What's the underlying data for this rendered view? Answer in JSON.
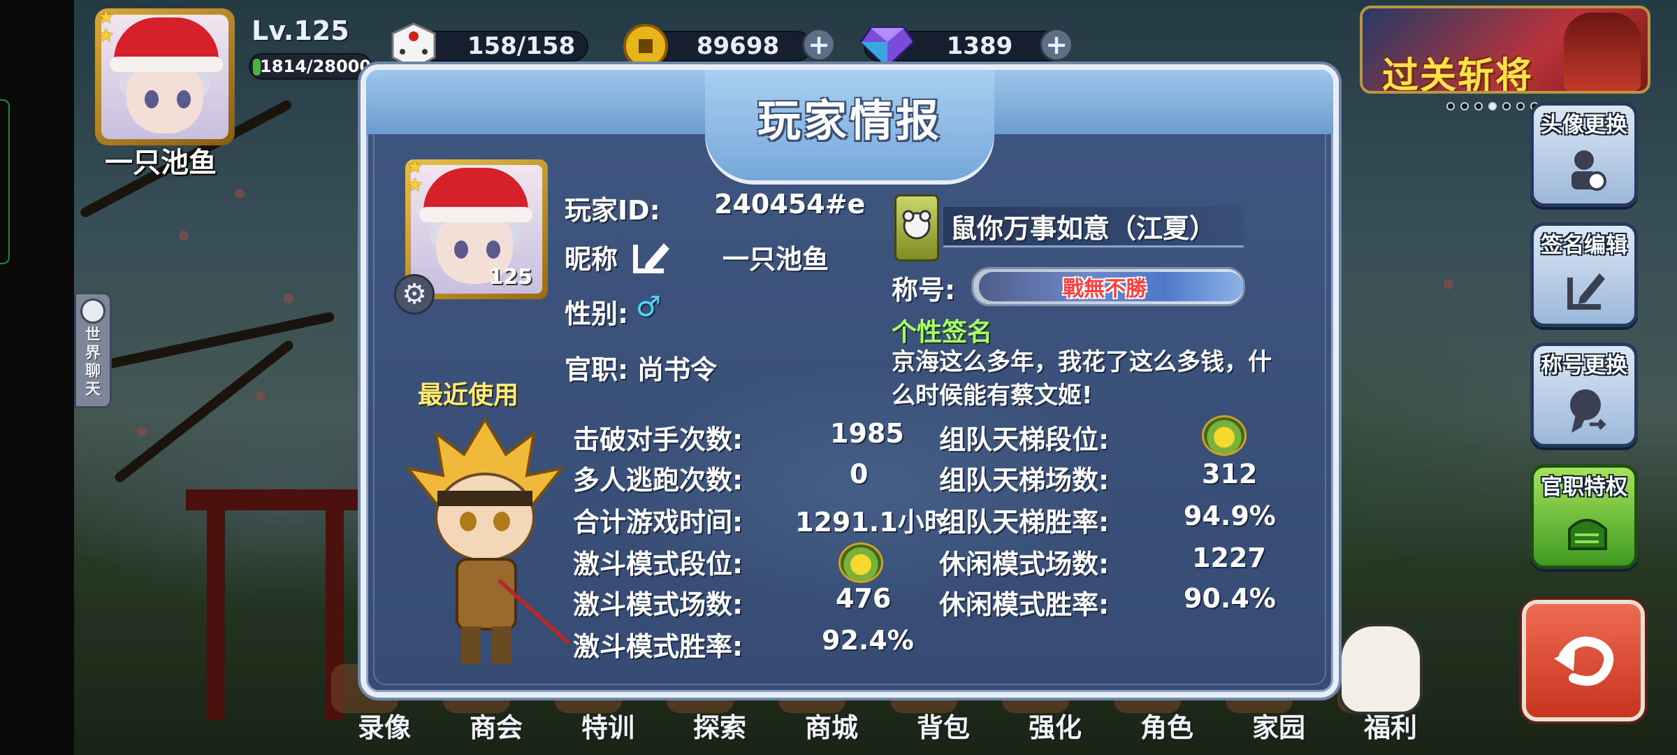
{
  "hud": {
    "player_name": "一只池鱼",
    "level": "Lv.125",
    "exp": "1814/28000",
    "exp_fraction": 0.065,
    "stamina": "158/158",
    "coins": "89698",
    "gems": "1389",
    "event_banner": "过关斩将"
  },
  "left_tab": {
    "label": [
      "世",
      "界",
      "聊",
      "天"
    ]
  },
  "bottom_menu": [
    "录像",
    "商会",
    "特训",
    "探索",
    "商城",
    "背包",
    "强化",
    "角色",
    "家园",
    "福利"
  ],
  "side_buttons": {
    "avatar": "头像更换",
    "signature": "签名编辑",
    "title": "称号更换",
    "privilege": "官职特权"
  },
  "panel": {
    "title": "玩家情报",
    "avatar_level": "125",
    "player_id_label": "玩家ID:",
    "player_id": "240454#e",
    "nickname_label": "昵称",
    "nickname": "一只池鱼",
    "gender_label": "性别:",
    "gender_symbol": "♂",
    "office_label": "官职:",
    "office": "尚书令",
    "guild_name": "鼠你万事如意（江夏）",
    "title_label": "称号:",
    "title_badge": "戰無不勝",
    "signature_label": "个性签名",
    "signature_text": "京海这么多年，我花了这么多钱，什么时候能有蔡文姬!",
    "recent_label": "最近使用"
  },
  "stats_left": [
    {
      "label": "击破对手次数:",
      "value": "1985"
    },
    {
      "label": "多人逃跑次数:",
      "value": "0"
    },
    {
      "label": "合计游戏时间:",
      "value": "1291.1小时"
    },
    {
      "label": "激斗模式段位:",
      "value": ""
    },
    {
      "label": "激斗模式场数:",
      "value": "476"
    },
    {
      "label": "激斗模式胜率:",
      "value": "92.4%"
    }
  ],
  "stats_right": [
    {
      "label": "组队天梯段位:",
      "value": ""
    },
    {
      "label": "组队天梯场数:",
      "value": "312"
    },
    {
      "label": "组队天梯胜率:",
      "value": "94.9%"
    },
    {
      "label": "休闲模式场数:",
      "value": "1227"
    },
    {
      "label": "休闲模式胜率:",
      "value": "90.4%"
    }
  ]
}
